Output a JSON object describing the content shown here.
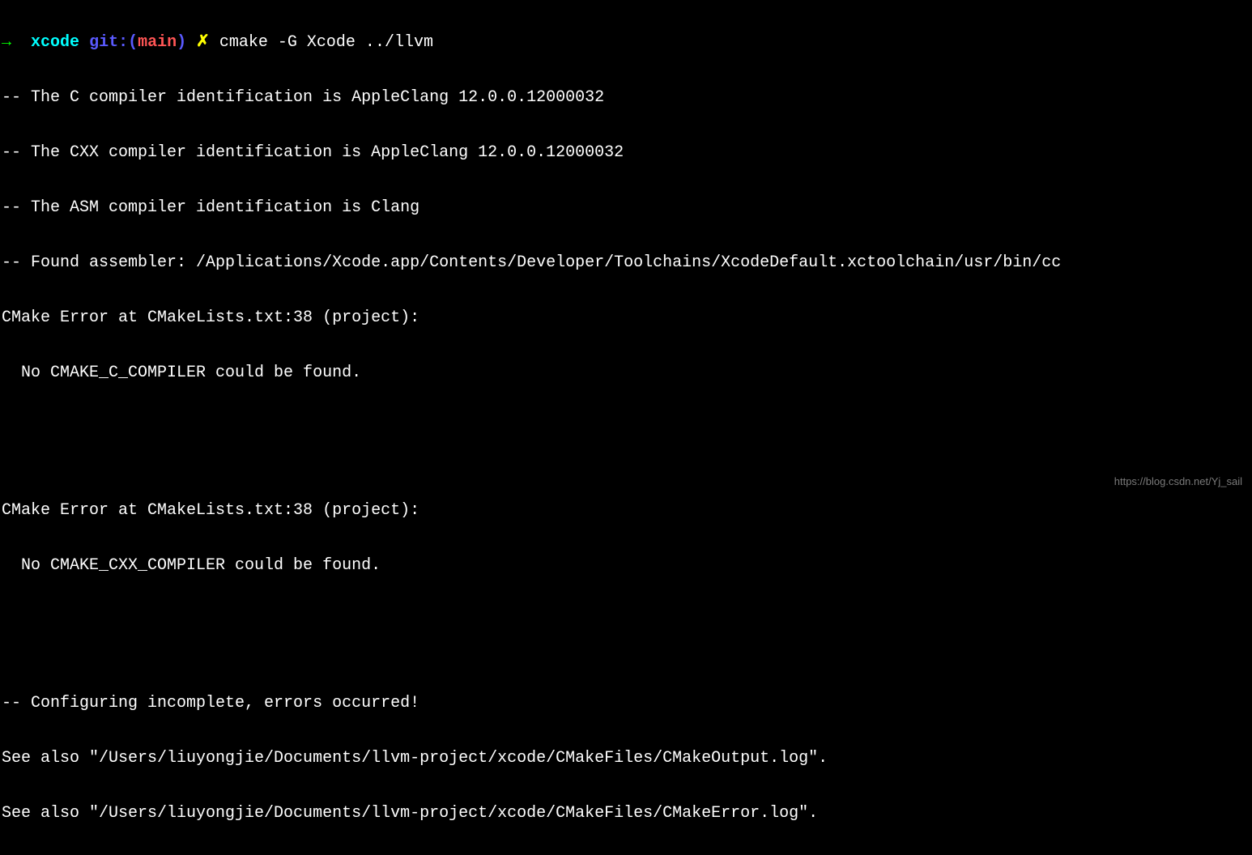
{
  "prompt": {
    "arrow": "→",
    "dir": "xcode",
    "git_label": "git:(",
    "branch": "main",
    "git_close": ")",
    "x": "✗",
    "command": "cmake -G Xcode ../llvm"
  },
  "lines": {
    "l1": "-- The C compiler identification is AppleClang 12.0.0.12000032",
    "l2": "-- The CXX compiler identification is AppleClang 12.0.0.12000032",
    "l3": "-- The ASM compiler identification is Clang",
    "l4": "-- Found assembler: /Applications/Xcode.app/Contents/Developer/Toolchains/XcodeDefault.xctoolchain/usr/bin/cc",
    "l5": "CMake Error at CMakeLists.txt:38 (project):",
    "l6": "  No CMAKE_C_COMPILER could be found.",
    "l7": "",
    "l8": "",
    "l9": "",
    "l10": "CMake Error at CMakeLists.txt:38 (project):",
    "l11": "  No CMAKE_CXX_COMPILER could be found.",
    "l12": "",
    "l13": "",
    "l14": "",
    "l15": "-- Configuring incomplete, errors occurred!",
    "l16": "See also \"/Users/liuyongjie/Documents/llvm-project/xcode/CMakeFiles/CMakeOutput.log\".",
    "l17": "See also \"/Users/liuyongjie/Documents/llvm-project/xcode/CMakeFiles/CMakeError.log\"."
  },
  "watermark": "https://blog.csdn.net/Yj_sail"
}
